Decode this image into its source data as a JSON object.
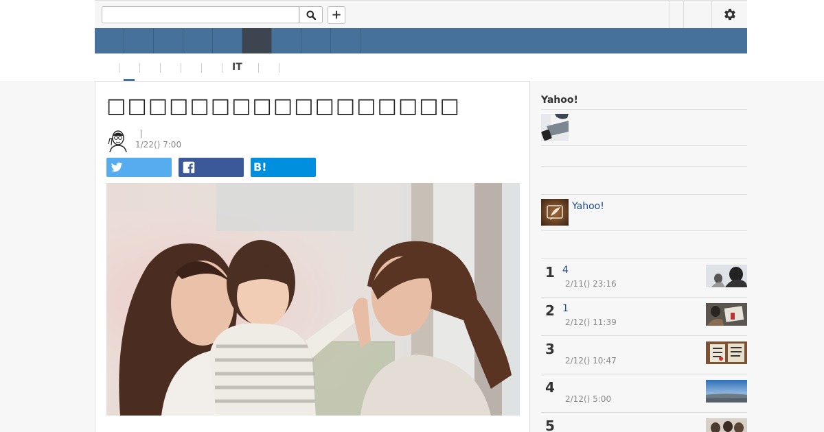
{
  "header": {
    "search": {
      "value": "",
      "placeholder": ""
    },
    "icons": {
      "search": "search-icon",
      "add": "plus-icon",
      "settings": "gear-icon"
    },
    "add_label": "+"
  },
  "subnav": {
    "it_label": "IT"
  },
  "article": {
    "title": "□□□□□□□□□□□□□□□□□",
    "author_separator": "|",
    "date": "1/22() 7:00"
  },
  "share": {
    "hatena_label": "B!"
  },
  "sidebar": {
    "heading": "Yahoo!",
    "promo_link": "Yahoo!",
    "ranking": [
      {
        "rank": "1",
        "title": "4",
        "date": "2/11() 23:16"
      },
      {
        "rank": "2",
        "title": "1",
        "date": "2/12() 11:39"
      },
      {
        "rank": "3",
        "title": "",
        "date": "2/12() 10:47"
      },
      {
        "rank": "4",
        "title": "",
        "date": "2/12() 5:00"
      },
      {
        "rank": "5",
        "title": "",
        "date": ""
      }
    ]
  },
  "colors": {
    "nav": "#46719a",
    "nav_active": "#3d4550",
    "twitter": "#55acee",
    "facebook": "#3b5998",
    "hatena": "#008fde",
    "link": "#1e4a8c"
  }
}
